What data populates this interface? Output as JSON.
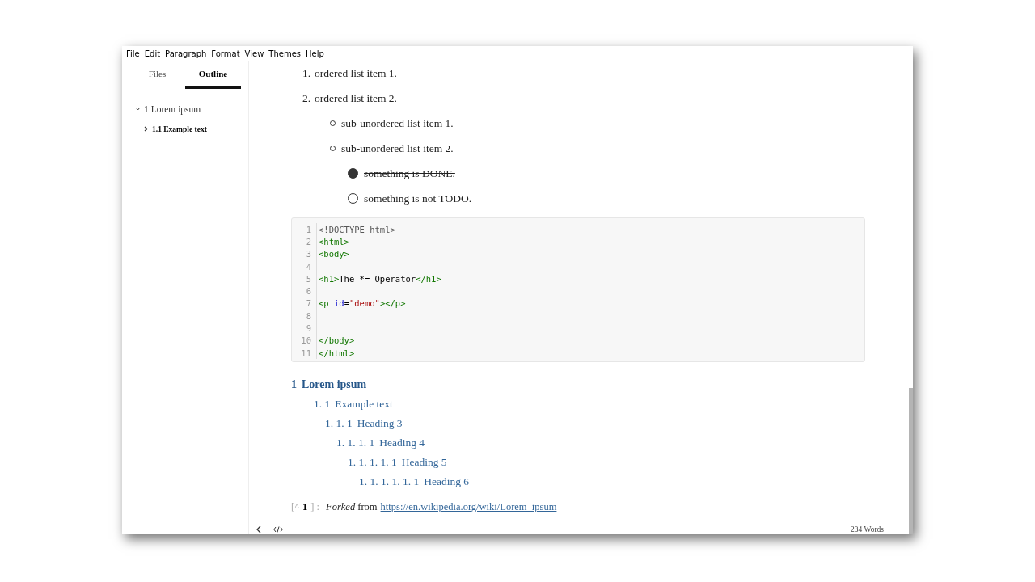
{
  "menu": [
    "File",
    "Edit",
    "Paragraph",
    "Format",
    "View",
    "Themes",
    "Help"
  ],
  "sidebar": {
    "tabs": [
      {
        "label": "Files",
        "selected": false
      },
      {
        "label": "Outline",
        "selected": true
      }
    ],
    "outline": [
      {
        "label": "1 Lorem ipsum",
        "expanded": true,
        "selected": false,
        "children": [
          {
            "label": "1.1 Example text",
            "expanded": false,
            "selected": true
          }
        ]
      }
    ]
  },
  "document": {
    "ordered_list": [
      {
        "number": "1.",
        "text": "ordered list item 1."
      },
      {
        "number": "2.",
        "text": "ordered list item 2.",
        "children": [
          {
            "text": "sub-unordered list item 1."
          },
          {
            "text": "sub-unordered list item 2.",
            "tasks": [
              {
                "text": "something is DONE.",
                "checked": true
              },
              {
                "text": "something is not TODO.",
                "checked": false
              }
            ]
          }
        ]
      }
    ],
    "code_block": {
      "lines": [
        {
          "number": "1",
          "tokens": [
            {
              "kind": "meta",
              "text": "<!DOCTYPE html>"
            }
          ]
        },
        {
          "number": "2",
          "tokens": [
            {
              "kind": "tag",
              "text": "<html>"
            }
          ]
        },
        {
          "number": "3",
          "tokens": [
            {
              "kind": "tag",
              "text": "<body>"
            }
          ]
        },
        {
          "number": "4"
        },
        {
          "number": "5",
          "tokens": [
            {
              "kind": "tag",
              "text": "<h1>"
            },
            {
              "kind": "plain",
              "text": "The *= Operator"
            },
            {
              "kind": "tag",
              "text": "</h1>"
            }
          ]
        },
        {
          "number": "6"
        },
        {
          "number": "7",
          "tokens": [
            {
              "kind": "tag",
              "text": "<p "
            },
            {
              "kind": "attr",
              "text": "id"
            },
            {
              "kind": "plain",
              "text": "="
            },
            {
              "kind": "string",
              "text": "\"demo\""
            },
            {
              "kind": "tag",
              "text": "></p>"
            }
          ]
        },
        {
          "number": "8"
        },
        {
          "number": "9"
        },
        {
          "number": "10",
          "tokens": [
            {
              "kind": "tag",
              "text": "</body>"
            }
          ]
        },
        {
          "number": "11",
          "tokens": [
            {
              "kind": "tag",
              "text": "</html>"
            }
          ]
        }
      ]
    },
    "toc": [
      {
        "number": "1",
        "text": "Lorem ipsum",
        "children": [
          {
            "number": "1. 1",
            "text": "Example text",
            "children": [
              {
                "number": "1. 1. 1",
                "text": "Heading 3",
                "children": [
                  {
                    "number": "1. 1. 1. 1",
                    "text": "Heading 4",
                    "children": [
                      {
                        "number": "1. 1. 1. 1. 1",
                        "text": "Heading 5",
                        "children": [
                          {
                            "number": "1. 1. 1. 1. 1. 1",
                            "text": "Heading 6"
                          }
                        ]
                      }
                    ]
                  }
                ]
              }
            ]
          }
        ]
      }
    ],
    "footnote": {
      "open": "[^",
      "number": "1",
      "close": "] :",
      "text": "*Forked* from",
      "url": "https://en.wikipedia.org/wiki/Lorem_ipsum"
    }
  },
  "status_bar": {
    "word_count": "234 Words"
  }
}
